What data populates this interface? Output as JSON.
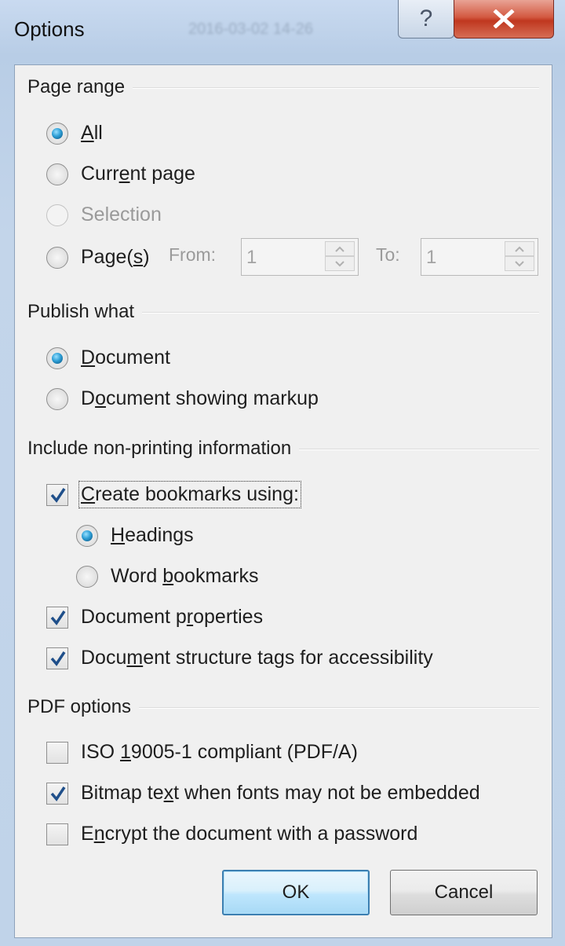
{
  "window": {
    "title": "Options",
    "background_title": "2016-03-02 14-26",
    "help_label": "?",
    "close_label": "X"
  },
  "page_range": {
    "label": "Page range",
    "all": {
      "pre": "",
      "u": "A",
      "post": "ll",
      "checked": true
    },
    "current": {
      "pre": "Curr",
      "u": "e",
      "post": "nt page",
      "checked": false
    },
    "selection": {
      "pre": "",
      "u": "",
      "post": "Selection",
      "disabled": true
    },
    "pages": {
      "pre": "Page(",
      "u": "s",
      "post": ")",
      "checked": false
    },
    "from_label": "From:",
    "from_value": "1",
    "to_label": "To:",
    "to_value": "1"
  },
  "publish_what": {
    "label": "Publish what",
    "document": {
      "pre": "",
      "u": "D",
      "post": "ocument",
      "checked": true
    },
    "markup": {
      "pre": "D",
      "u": "o",
      "post": "cument showing markup",
      "checked": false
    }
  },
  "non_printing": {
    "label": "Include non-printing information",
    "bookmarks": {
      "pre": "",
      "u": "C",
      "post": "reate bookmarks using:",
      "checked": true
    },
    "headings": {
      "pre": "",
      "u": "H",
      "post": "eadings",
      "checked": true
    },
    "word_bookmarks": {
      "pre": "Word ",
      "u": "b",
      "post": "ookmarks",
      "checked": false
    },
    "properties": {
      "pre": "Document p",
      "u": "r",
      "post": "operties",
      "checked": true
    },
    "structure_tags": {
      "pre": "Docu",
      "u": "m",
      "post": "ent structure tags for accessibility",
      "checked": true
    }
  },
  "pdf_options": {
    "label": "PDF options",
    "iso": {
      "pre": "ISO ",
      "u": "1",
      "post": "9005-1 compliant (PDF/A)",
      "checked": false
    },
    "bitmap": {
      "pre": "Bitmap te",
      "u": "x",
      "post": "t when fonts may not be embedded",
      "checked": true
    },
    "encrypt": {
      "pre": "E",
      "u": "n",
      "post": "crypt the document with a password",
      "checked": false
    }
  },
  "buttons": {
    "ok": "OK",
    "cancel": "Cancel"
  },
  "colors": {
    "close": "#c0371f",
    "radio_dot": "#2e9fd6",
    "check": "#1f4f8a"
  }
}
